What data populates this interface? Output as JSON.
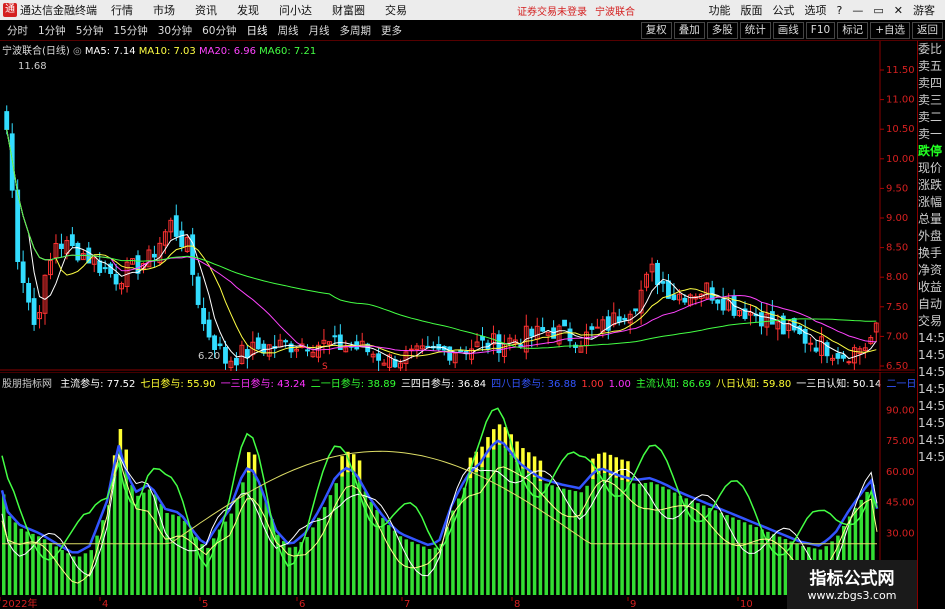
{
  "menubar": {
    "app_title": "通达信金融终端",
    "items": [
      "行情",
      "市场",
      "资讯",
      "发现",
      "问小达",
      "财富圈",
      "交易"
    ],
    "warning": "证券交易未登录",
    "stock_name": "宁波联合",
    "right_items": [
      "功能",
      "版面",
      "公式",
      "选项"
    ],
    "guest": "游客"
  },
  "toolbar": {
    "periods": [
      "分时",
      "1分钟",
      "5分钟",
      "15分钟",
      "30分钟",
      "60分钟",
      "日线",
      "周线",
      "月线",
      "多周期",
      "更多"
    ],
    "active_period": "日线",
    "buttons": [
      "复权",
      "叠加",
      "多股",
      "统计",
      "画线",
      "F10",
      "标记",
      "+自选",
      "返回"
    ]
  },
  "main_chart": {
    "title": "宁波联合(日线)",
    "ma5": "MA5: 7.14",
    "ma10": "MA10: 7.03",
    "ma20": "MA20: 6.96",
    "ma60": "MA60: 7.21",
    "high_label": "11.68",
    "low_label": "6.20",
    "y_ticks": [
      "11.50",
      "11.00",
      "10.50",
      "10.00",
      "9.50",
      "9.00",
      "8.50",
      "8.00",
      "7.50",
      "7.00",
      "6.50"
    ],
    "marker_s": "S"
  },
  "indicator": {
    "name": "股朋指标网",
    "items": [
      {
        "text": "主流参与: 77.52",
        "color": "#ffffff"
      },
      {
        "text": "七日参与: 55.90",
        "color": "#ffff33"
      },
      {
        "text": "一三日参与: 43.24",
        "color": "#ff33ff"
      },
      {
        "text": "二一日参与: 38.89",
        "color": "#33ff33"
      },
      {
        "text": "三四日参与: 36.84",
        "color": "#ffffff"
      },
      {
        "text": "四八日参与: 36.88",
        "color": "#3355ff"
      },
      {
        "text": "1.00",
        "color": "#ff3333"
      },
      {
        "text": "1.00",
        "color": "#ff33ff"
      },
      {
        "text": "主流认知: 86.69",
        "color": "#33ff33"
      },
      {
        "text": "八日认知: 59.80",
        "color": "#ffff33"
      },
      {
        "text": "一三日认知: 50.14",
        "color": "#ffffff"
      },
      {
        "text": "二一日认",
        "color": "#3355ff"
      }
    ],
    "y_ticks": [
      "90.00",
      "75.00",
      "60.00",
      "45.00",
      "30.00",
      "15.00"
    ]
  },
  "x_axis": [
    "2022年",
    "4",
    "5",
    "6",
    "7",
    "8",
    "9",
    "10"
  ],
  "sidebar": {
    "labels": [
      "委比",
      "卖五",
      "卖四",
      "卖三",
      "卖二",
      "卖一",
      "",
      "",
      "跌停",
      "",
      "",
      "",
      "现价",
      "涨跌",
      "涨幅",
      "总量",
      "外盘",
      "换手",
      "净资",
      "收益",
      "",
      "自动",
      "交易",
      "14:54",
      "14:54",
      "14:55",
      "14:55",
      "14:55",
      "14:55",
      "14:56",
      "14:56"
    ]
  },
  "watermark": {
    "line1": "指标公式网",
    "line2": "www.zbgs3.com"
  }
}
